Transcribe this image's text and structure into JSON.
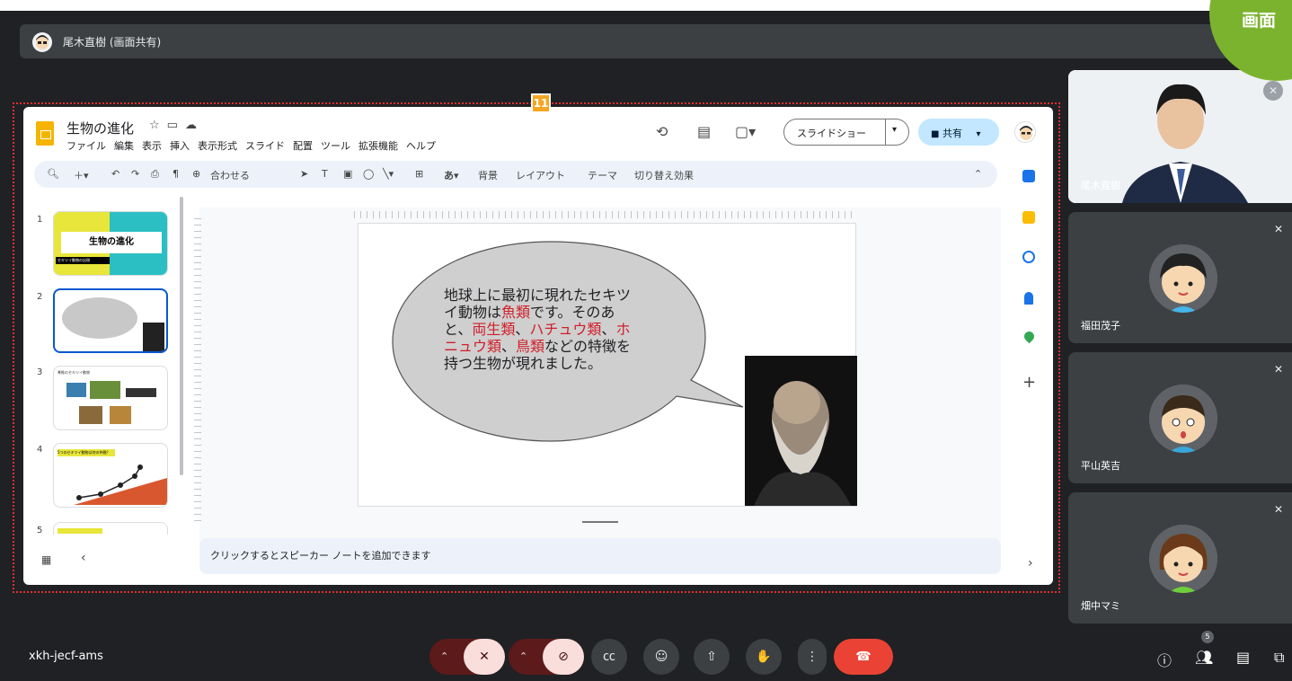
{
  "corner_badge": "画面",
  "step_marker": "11",
  "presenter_bar": {
    "name": "尾木直樹 (画面共有)"
  },
  "slides_app": {
    "title": "生物の進化",
    "title_icons": [
      "star-icon",
      "folder-icon",
      "cloud-icon"
    ],
    "menu": [
      "ファイル",
      "編集",
      "表示",
      "挿入",
      "表示形式",
      "スライド",
      "配置",
      "ツール",
      "拡張機能",
      "ヘルプ"
    ],
    "slideshow_label": "スライドショー",
    "share_label": "共有",
    "toolbar": {
      "zoom_label": "合わせる",
      "background": "背景",
      "layout": "レイアウト",
      "theme": "テーマ",
      "transition": "切り替え効果"
    },
    "thumbnails": [
      {
        "num": "1",
        "title": "生物の進化",
        "subtitle": "セキツイ動物の出現"
      },
      {
        "num": "2"
      },
      {
        "num": "3",
        "title": "脊椎のセキツイ動物"
      },
      {
        "num": "4",
        "title": "5つのセキツイ動物は何の仲間？"
      },
      {
        "num": "5"
      }
    ],
    "slide_text": {
      "l1": "地球上に最初に現れたセキツ",
      "l2a": "イ動物は",
      "l2b": "魚類",
      "l2c": "です。そのあ",
      "l3a": "と、",
      "l3b": "両生類",
      "l3c": "、",
      "l3d": "ハチュウ類",
      "l3e": "、",
      "l3f": "ホ",
      "l4a": "ニュウ類",
      "l4b": "、",
      "l4c": "鳥類",
      "l4d": "などの特徴を",
      "l5": "持つ生物が現れました。"
    },
    "notes_placeholder": "クリックするとスピーカー ノートを追加できます"
  },
  "participants": [
    {
      "name": "尾木直樹"
    },
    {
      "name": "福田茂子"
    },
    {
      "name": "平山英吉"
    },
    {
      "name": "畑中マミ"
    }
  ],
  "bottom_bar": {
    "meeting_code": "xkh-jecf-ams",
    "people_count": "5"
  },
  "colors": {
    "accent_red": "#d0202a",
    "meet_red": "#ea4335",
    "badge_green": "#7bb32e"
  }
}
